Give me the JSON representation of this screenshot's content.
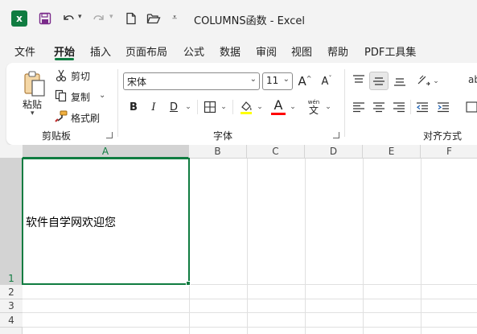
{
  "titlebar": {
    "title": "COLUMNS函数  -  Excel",
    "app_icon_letter": "x"
  },
  "menu": {
    "tabs": [
      "文件",
      "开始",
      "插入",
      "页面布局",
      "公式",
      "数据",
      "审阅",
      "视图",
      "帮助",
      "PDF工具集"
    ],
    "active_index": 1
  },
  "ribbon": {
    "clipboard": {
      "paste_label": "粘贴",
      "cut_label": "剪切",
      "copy_label": "复制",
      "format_painter_label": "格式刷",
      "group_label": "剪贴板"
    },
    "font": {
      "font_name": "宋体",
      "font_size": "11",
      "bold": "B",
      "italic": "I",
      "underline": "D",
      "wen": "wén",
      "wen_char": "文",
      "font_color_letter": "A",
      "grow_letter": "A",
      "shrink_letter": "A",
      "group_label": "字体",
      "font_color": "#ff0000"
    },
    "alignment": {
      "group_label": "对齐方式",
      "wrap_partial": "ab"
    }
  },
  "grid": {
    "columns": [
      "A",
      "B",
      "C",
      "D",
      "E",
      "F"
    ],
    "rows": [
      "1",
      "2",
      "3",
      "4"
    ],
    "selected_column": "A",
    "selected_row": "1",
    "cell_a1": "软件自学网欢迎您",
    "accent_color": "#107c41"
  }
}
